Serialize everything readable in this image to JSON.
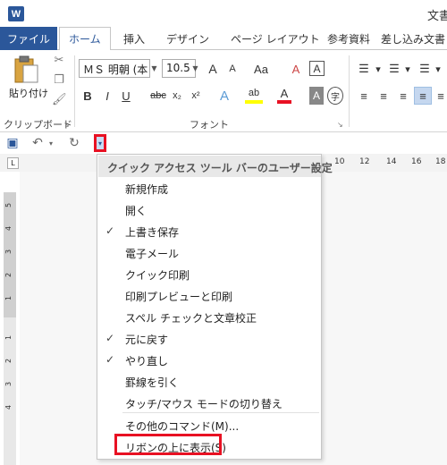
{
  "window": {
    "app_logo": "W",
    "doc_title": "文書"
  },
  "tabs": {
    "file": "ファイル",
    "items": [
      "ホーム",
      "挿入",
      "デザイン",
      "ページ レイアウト",
      "参考資料",
      "差し込み文書"
    ],
    "active_index": 0
  },
  "ribbon": {
    "clipboard": {
      "paste_label": "貼り付け",
      "group_label": "クリップボード"
    },
    "font": {
      "font_name": "ＭＳ 明朝 (本",
      "font_size": "10.5",
      "group_label": "フォント",
      "grow": "A",
      "shrink": "A",
      "change_case": "Aa",
      "clear_format": "A",
      "char_border": "A",
      "bold": "B",
      "italic": "I",
      "underline": "U",
      "strike": "abc",
      "subscript": "x₂",
      "superscript": "x²",
      "text_effect": "A",
      "highlight": "ab",
      "font_color": "A",
      "shading": "A",
      "enclose": "字"
    }
  },
  "ruler": {
    "tab_stop": "L",
    "numbers": [
      "10",
      "12",
      "14",
      "16",
      "18"
    ],
    "vertical_numbers": [
      "5",
      "4",
      "3",
      "2",
      "1",
      "1",
      "2",
      "3",
      "4"
    ]
  },
  "qat_menu": {
    "header": "クイック アクセス ツール バーのユーザー設定",
    "items": [
      {
        "label": "新規作成",
        "checked": false
      },
      {
        "label": "開く",
        "checked": false
      },
      {
        "label": "上書き保存",
        "checked": true
      },
      {
        "label": "電子メール",
        "checked": false
      },
      {
        "label": "クイック印刷",
        "checked": false
      },
      {
        "label": "印刷プレビューと印刷",
        "checked": false
      },
      {
        "label": "スペル チェックと文章校正",
        "checked": false
      },
      {
        "label": "元に戻す",
        "checked": true
      },
      {
        "label": "やり直し",
        "checked": true
      },
      {
        "label": "罫線を引く",
        "checked": false
      },
      {
        "label": "タッチ/マウス モードの切り替え",
        "checked": false
      }
    ],
    "more_commands": "その他のコマンド(M)...",
    "show_below": "リボンの上に表示(S)",
    "check_glyph": "✓"
  },
  "colors": {
    "brand": "#2b579a",
    "callout": "#e81123"
  }
}
